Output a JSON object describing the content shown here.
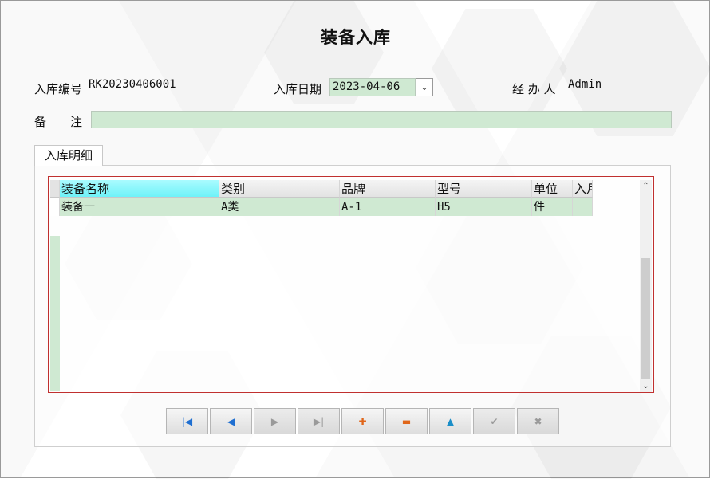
{
  "form": {
    "title": "装备入库",
    "receipt_no_label": "入库编号",
    "receipt_no_value": "RK20230406001",
    "date_label": "入库日期",
    "date_value": "2023-04-06",
    "handler_label": "经 办 人",
    "handler_value": "Admin",
    "remark_label": "备　　注",
    "remark_value": ""
  },
  "tabs": [
    {
      "label": "入库明细"
    }
  ],
  "grid": {
    "columns": [
      "装备名称",
      "类别",
      "品牌",
      "型号",
      "单位",
      "入月"
    ],
    "rows": [
      [
        "装备一",
        "A类",
        "A-1",
        "H5",
        "件",
        ""
      ]
    ]
  },
  "navigator": {
    "buttons": [
      {
        "name": "first-record-icon",
        "glyph": "|◀",
        "color": "#1f6fd1",
        "enabled": true
      },
      {
        "name": "prior-record-icon",
        "glyph": "◀",
        "color": "#1f6fd1",
        "enabled": true
      },
      {
        "name": "next-record-icon",
        "glyph": "▶",
        "color": "#9a9a9a",
        "enabled": false
      },
      {
        "name": "last-record-icon",
        "glyph": "▶|",
        "color": "#9a9a9a",
        "enabled": false
      },
      {
        "name": "insert-record-icon",
        "glyph": "✚",
        "color": "#e0661a",
        "enabled": true
      },
      {
        "name": "delete-record-icon",
        "glyph": "▬",
        "color": "#e0661a",
        "enabled": true
      },
      {
        "name": "edit-record-icon",
        "glyph": "▲",
        "color": "#1b8ec8",
        "enabled": true
      },
      {
        "name": "post-record-icon",
        "glyph": "✔",
        "color": "#9a9a9a",
        "enabled": false
      },
      {
        "name": "cancel-record-icon",
        "glyph": "✖",
        "color": "#9a9a9a",
        "enabled": false
      }
    ]
  },
  "colors": {
    "input_bg": "#cfe9d2",
    "active_header": "#7ff5fa",
    "grid_border": "#c0302f"
  }
}
